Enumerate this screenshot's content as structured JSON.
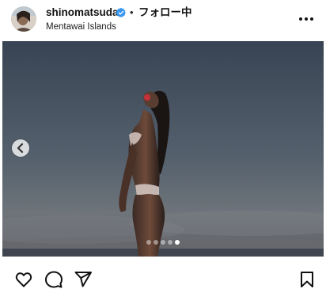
{
  "header": {
    "username": "shinomatsuda",
    "separator": "•",
    "follow_label": "フォロー中",
    "location": "Mentawai Islands",
    "verified_icon": "verified-badge-icon",
    "more_icon": "more-options-icon"
  },
  "carousel": {
    "total_slides": 5,
    "current_slide": 5,
    "prev_icon": "chevron-left-icon"
  },
  "actions": {
    "icons": [
      "heart-icon",
      "comment-icon",
      "share-icon",
      "bookmark-icon"
    ]
  },
  "colors": {
    "verified": "#3897f0",
    "text": "#111111"
  }
}
